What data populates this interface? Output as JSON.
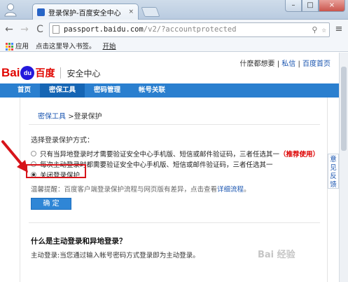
{
  "browser": {
    "tab_title": "登录保护-百度安全中心",
    "tab_close": "×",
    "favicon": "🐾",
    "window_min": "–",
    "window_max": "□",
    "window_close": "×",
    "back": "←",
    "forward": "→",
    "reload": "C",
    "url_host": "passport.baidu.com",
    "url_path": "/v2/?accountprotected",
    "star": "☆",
    "wrench": "≡",
    "bookmarks": {
      "apps_label": "应用",
      "import_label": "点击这里导入书签。",
      "start_label": "开始"
    }
  },
  "page": {
    "top_links": {
      "greeting": "什麽都想要",
      "sep1": "|",
      "messages": "私信",
      "sep2": "|",
      "home": "百度首页"
    },
    "logo": {
      "bai": "Bai",
      "du": "du",
      "cn": "百度"
    },
    "header_title": "安全中心",
    "nav": [
      {
        "label": "首页"
      },
      {
        "label": "密保工具"
      },
      {
        "label": "密码管理"
      },
      {
        "label": "帐号关联"
      }
    ],
    "breadcrumb": {
      "link": "密保工具",
      "sep": ">",
      "current": "登录保护"
    },
    "section_label": "选择登录保护方式：",
    "options": [
      {
        "text": "只有当异地登录时才需要验证安全中心手机版、短信或邮件验证码，三者任选其一",
        "badge": "（推荐使用）",
        "checked": false
      },
      {
        "text": "每次主动登录时都需要验证安全中心手机版、短信或邮件验证码，三者任选其一",
        "checked": false
      },
      {
        "text": "关闭登录保护",
        "checked": true
      }
    ],
    "hint": {
      "text": "温馨提醒：百度客户端登录保护流程与网页版有差异，点击查看",
      "link": "详细流程",
      "end": "。"
    },
    "confirm_label": "确 定",
    "question_title": "什么是主动登录和异地登录？",
    "question_desc": "主动登录:当您通过输入帐号密码方式登录即为主动登录。",
    "feedback_label": "意见反馈",
    "watermark": "Bai 经验"
  }
}
